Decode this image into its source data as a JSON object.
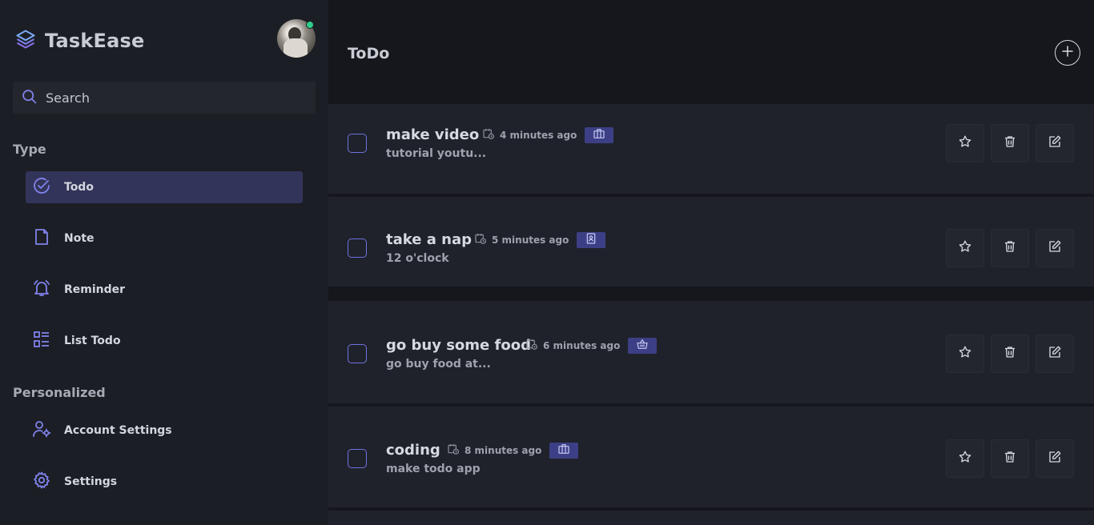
{
  "brand": {
    "name": "TaskEase",
    "icon": "stack-layers-icon"
  },
  "search": {
    "placeholder": "Search",
    "icon": "search-icon"
  },
  "sidebar": {
    "type_title": "Type",
    "type_items": [
      {
        "label": "Todo",
        "icon": "check-circle-icon",
        "active": true
      },
      {
        "label": "Note",
        "icon": "note-icon",
        "active": false
      },
      {
        "label": "Reminder",
        "icon": "bell-icon",
        "active": false
      },
      {
        "label": "List Todo",
        "icon": "list-icon",
        "active": false
      }
    ],
    "personal_title": "Personalized",
    "personal_items": [
      {
        "label": "Account Settings",
        "icon": "user-gear-icon"
      },
      {
        "label": "Settings",
        "icon": "gear-icon"
      }
    ]
  },
  "main": {
    "title": "ToDo",
    "add_icon": "plus-circle-icon"
  },
  "todos": [
    {
      "title": "make video",
      "time": "4 minutes ago",
      "tag": "briefcase-icon",
      "desc": "tutorial youtu..."
    },
    {
      "title": "take a nap",
      "time": "5 minutes ago",
      "tag": "contact-book-icon",
      "desc": "12 o'clock"
    },
    {
      "title": "go buy some food",
      "time": "6 minutes ago",
      "tag": "basket-icon",
      "desc": "go buy food at..."
    },
    {
      "title": "coding",
      "time": "8 minutes ago",
      "tag": "briefcase-icon",
      "desc": "make todo app"
    }
  ],
  "colors": {
    "accent": "#6f73e0",
    "active_bg": "#33345a",
    "tag_bg": "#3d3f86",
    "online": "#2ccf8a"
  }
}
